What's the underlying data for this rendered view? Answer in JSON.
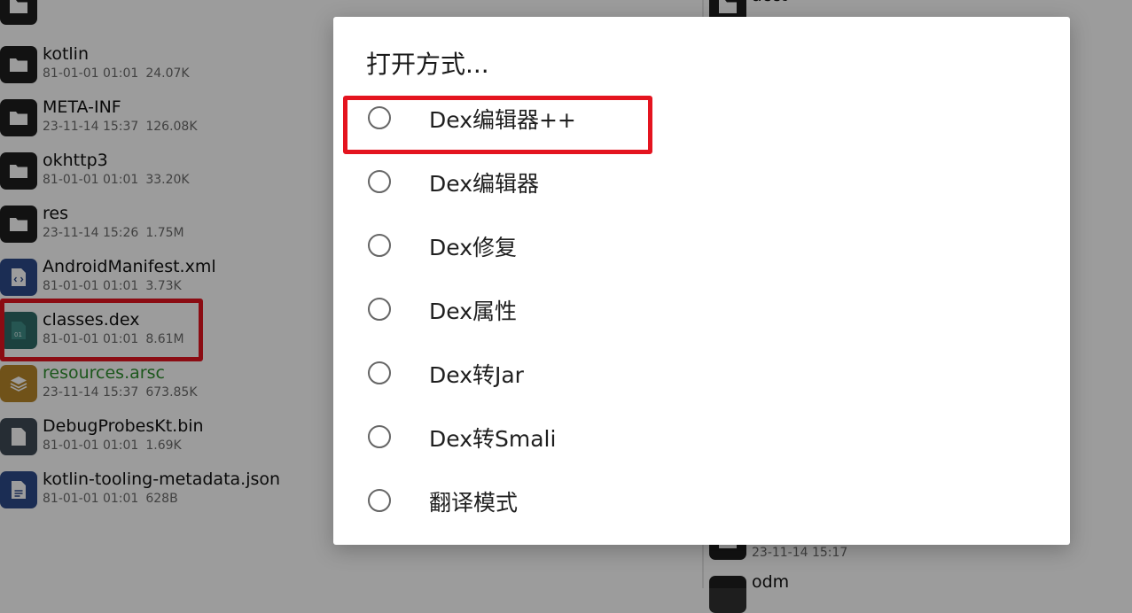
{
  "file_list": {
    "parent_label": "..",
    "items": [
      {
        "name": "kotlin",
        "date": "81-01-01 01:01",
        "size": "24.07K",
        "type": "folder"
      },
      {
        "name": "META-INF",
        "date": "23-11-14 15:37",
        "size": "126.08K",
        "type": "folder"
      },
      {
        "name": "okhttp3",
        "date": "81-01-01 01:01",
        "size": "33.20K",
        "type": "folder"
      },
      {
        "name": "res",
        "date": "23-11-14 15:26",
        "size": "1.75M",
        "type": "folder"
      },
      {
        "name": "AndroidManifest.xml",
        "date": "81-01-01 01:01",
        "size": "3.73K",
        "type": "xml"
      },
      {
        "name": "classes.dex",
        "date": "81-01-01 01:01",
        "size": "8.61M",
        "type": "dex"
      },
      {
        "name": "resources.arsc",
        "date": "23-11-14 15:37",
        "size": "673.85K",
        "type": "arsc"
      },
      {
        "name": "DebugProbesKt.bin",
        "date": "81-01-01 01:01",
        "size": "1.69K",
        "type": "bin"
      },
      {
        "name": "kotlin-tooling-metadata.json",
        "date": "81-01-01 01:01",
        "size": "628B",
        "type": "json"
      }
    ]
  },
  "right_pane": {
    "items": [
      {
        "name": "acct",
        "date": ""
      },
      {
        "name": "",
        "date": "23-11-14 15:17"
      },
      {
        "name": "odm",
        "date": ""
      }
    ]
  },
  "dialog": {
    "title": "打开方式...",
    "options": [
      {
        "label": "Dex编辑器++",
        "highlighted": true
      },
      {
        "label": "Dex编辑器",
        "highlighted": false
      },
      {
        "label": "Dex修复",
        "highlighted": false
      },
      {
        "label": "Dex属性",
        "highlighted": false
      },
      {
        "label": "Dex转Jar",
        "highlighted": false
      },
      {
        "label": "Dex转Smali",
        "highlighted": false
      },
      {
        "label": "翻译模式",
        "highlighted": false
      }
    ]
  },
  "colors": {
    "folder_icon": "#1e1e1e",
    "xml_icon": "#2d4a8a",
    "dex_icon": "#2e6b67",
    "arsc_icon": "#b8862a",
    "bin_icon": "#3e4a56",
    "json_icon": "#2d4a8a",
    "arsc_name": "#2f8f2f",
    "highlight": "#e4141f",
    "scrim": "rgba(0,0,0,0.39)"
  },
  "icons": {
    "folder": "folder-icon",
    "xml": "code-file-icon",
    "dex": "binary-file-icon",
    "arsc": "layers-icon",
    "bin": "file-icon",
    "json": "document-icon"
  }
}
